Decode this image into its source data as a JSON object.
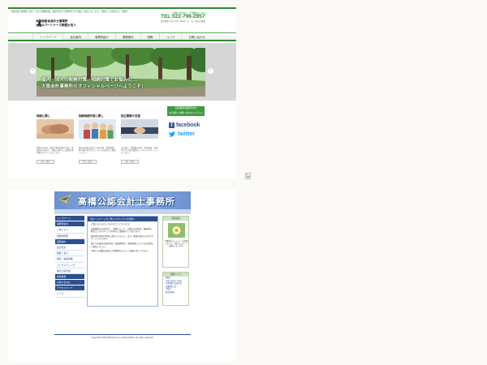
{
  "colors": {
    "site1_green": "#2e8b2e",
    "site2_navy": "#2b4f8f",
    "page_bg": "#fbfaf6"
  },
  "site1": {
    "top_strip": "大阪府会計事務所 | 個人・法人の税務対策・確定申告から経理代行まで幅広く対応いたします。大阪市 | 公認会計士・税理士",
    "logo_icon": "deer-logo-icon",
    "firm_name_line1": "大阪坂総合会計士事務所",
    "firm_name_line2": "大阪&パートナーズ税理士法人",
    "tel_caption": "お問い合わせ・ご相談はこちら",
    "tel": "TEL 022-796-2957",
    "hours": "受付時間 平日 9:00〜18:00（土・日・祝日は休業）",
    "nav": [
      "トップページ",
      "会社案内",
      "事業所紹介",
      "業務案内",
      "税務",
      "リンク",
      "お問い合わせ"
    ],
    "hero": {
      "line1": "個人・法人の税務対策、相続対策でお悩みの...",
      "line2": "大阪会計事務所のオフィシャルページへようこそ！"
    },
    "carousel": {
      "prev": "‹",
      "next": "›"
    },
    "columns": [
      {
        "title": "相続に関し",
        "text": "相続の手続き、遺産分割協議書の作成、相続税の申告など、相続に関するご相談を専門家がサポートいたします。",
        "button": "詳しく見る"
      },
      {
        "title": "相続相続対策に関し",
        "text": "将来の相続に備えた生前対策、事業承継、贈与税の申告などについてお気軽にご相談ください。",
        "button": "詳しく見る"
      },
      {
        "title": "独立開業の支援",
        "text": "会社設立、開業届の提出、資金調達、記帳代行まで独立開業をトータルでサポートいたします。",
        "button": "詳しく見る"
      }
    ],
    "contact_box": {
      "line1": "初回無料相談受付中",
      "line2": "お気軽にお問い合わせください"
    },
    "social": {
      "facebook": "facebook",
      "twitter": "twitter"
    }
  },
  "site2": {
    "banner_title": "高橋公認会計士事務所",
    "banner_sub": "TAKAHASHI ACCOUNTING OFFICE",
    "sidebar": [
      {
        "label": "トップページ",
        "sub": false
      },
      {
        "label": "事務所案内",
        "sub": false
      },
      {
        "label": "ごあいさつ",
        "sub": true
      },
      {
        "label": "事務所概要",
        "sub": true
      },
      {
        "label": "業務案内",
        "sub": false
      },
      {
        "label": "会計監査",
        "sub": true
      },
      {
        "label": "税務・会計",
        "sub": true
      },
      {
        "label": "相続・事業承継",
        "sub": true
      },
      {
        "label": "コンサルティング",
        "sub": true
      },
      {
        "label": "株式公開支援",
        "sub": true
      },
      {
        "label": "採用情報",
        "sub": false
      },
      {
        "label": "お問い合わせ",
        "sub": false
      },
      {
        "label": "アクセスマップ",
        "sub": false
      },
      {
        "label": "リンク",
        "sub": true
      }
    ],
    "main_heading": "当ホームページをご覧いただいている皆様へ",
    "main_paragraphs": [
      "ご覧いただきましてありがとうございます。",
      "当事務所は公認会計士・税理士として、企業の会計監査、税務申告、経営コンサルティングを中心に業務を行っております。",
      "経営者の皆様が本業に専念できるよう、会計・税務の面から全力でサポートいたします。",
      "個人のお客様の確定申告、相続税申告、事業承継についてもお気軽にご相談ください。",
      "今後とも高橋公認会計士事務所をよろしくお願い申し上げます。"
    ],
    "right_box_title": "新着情報",
    "right_box_text": "事務所のホームページを開設しました。今後ともよろしくお願いいたします。",
    "links_title": "関連リンク",
    "links": [
      "国税庁",
      "日本公認会計士協会",
      "日本税理士会連合会",
      "近畿税理士会",
      "大阪府",
      "経済産業省"
    ],
    "footer": "Copyright 2008 Takahashi Accounting Office. All rights reserved."
  }
}
